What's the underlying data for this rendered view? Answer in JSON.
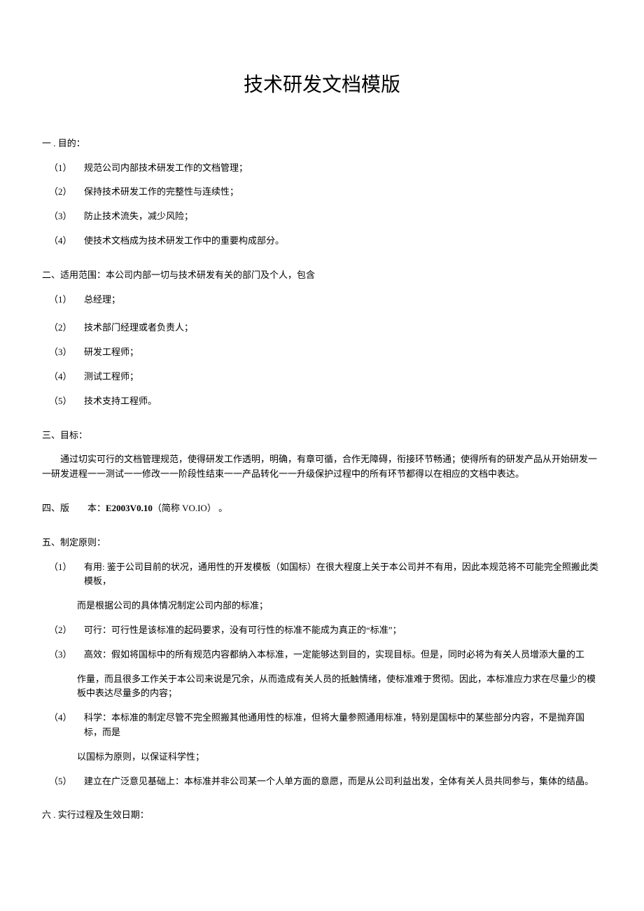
{
  "title": "技术研发文档模版",
  "section1": {
    "heading": "一 . 目的：",
    "items": [
      {
        "num": "（1）",
        "text": "规范公司内部技术研发工作的文档管理；"
      },
      {
        "num": "（2）",
        "text": "保持技术研发工作的完整性与连续性；"
      },
      {
        "num": "（3）",
        "text": "防止技术流失，减少风险；"
      },
      {
        "num": "（4）",
        "text": "使技术文档成为技术研发工作中的重要构成部分。"
      }
    ]
  },
  "section2": {
    "heading": "二、适用范围：本公司内部一切与技术研发有关的部门及个人，包含",
    "items": [
      {
        "num": "（1）",
        "text": "总经理；"
      },
      {
        "num": "（2）",
        "text": "技术部门经理或者负责人；"
      },
      {
        "num": "（3）",
        "text": "研发工程师；"
      },
      {
        "num": "（4）",
        "text": "测试工程师；"
      },
      {
        "num": "（5）",
        "text": "技术支持工程师。"
      }
    ]
  },
  "section3": {
    "heading": "三、目标：",
    "body": "通过切实可行的文档管理规范，使得研发工作透明，明确，有章可循，合作无障碍，衔接环节畅通；使得所有的研发产品从开始研发一一研发进程一一测试一一修改一一阶段性结束一一产品转化一一升级保护过程中的所有环节都得以在相应的文档中表达。"
  },
  "section4": {
    "prefix": "四、版　　本：",
    "version": "E2003V0.10",
    "suffix": "（简称 VO.IO） 。"
  },
  "section5": {
    "heading": "五、制定原则：",
    "items": [
      {
        "num": "（1）",
        "text": "有用: 鉴于公司目前的状况，通用性的开发模板（如国标）在很大程度上关于本公司并不有用，因此本规范将不可能完全照搬此类模板，",
        "nested": "而是根据公司的具体情况制定公司内部的标准；"
      },
      {
        "num": "（2）",
        "text": "可行：可行性是该标准的起码要求，没有可行性的标准不能成为真正的“标准”；",
        "nested": null
      },
      {
        "num": "（3）",
        "text": "高效：假如将国标中的所有规范内容都纳入本标准，一定能够达到目的，实现目标。但是，同时必将为有关人员增添大量的工",
        "nested": "作量，而且很多工作关于本公司来说是冗余，从而造成有关人员的抵触情绪，使标准难于贯彻。因此，本标准应力求在尽量少的模板中表达尽量多的内容；"
      },
      {
        "num": "（4）",
        "text": "科学：本标准的制定尽管不完全照搬其他通用性的标准，但将大量参照通用标准，特别是国标中的某些部分内容，不是抛弃国标，而是",
        "nested": "以国标为原则，以保证科学性；"
      },
      {
        "num": "（5）",
        "text": "建立在广泛意见基础上：本标准并非公司某一个人单方面的意愿，而是从公司利益出发，全体有关人员共同参与，集体的结晶。",
        "nested": null
      }
    ]
  },
  "section6": {
    "heading": "六 . 实行过程及生效日期："
  }
}
